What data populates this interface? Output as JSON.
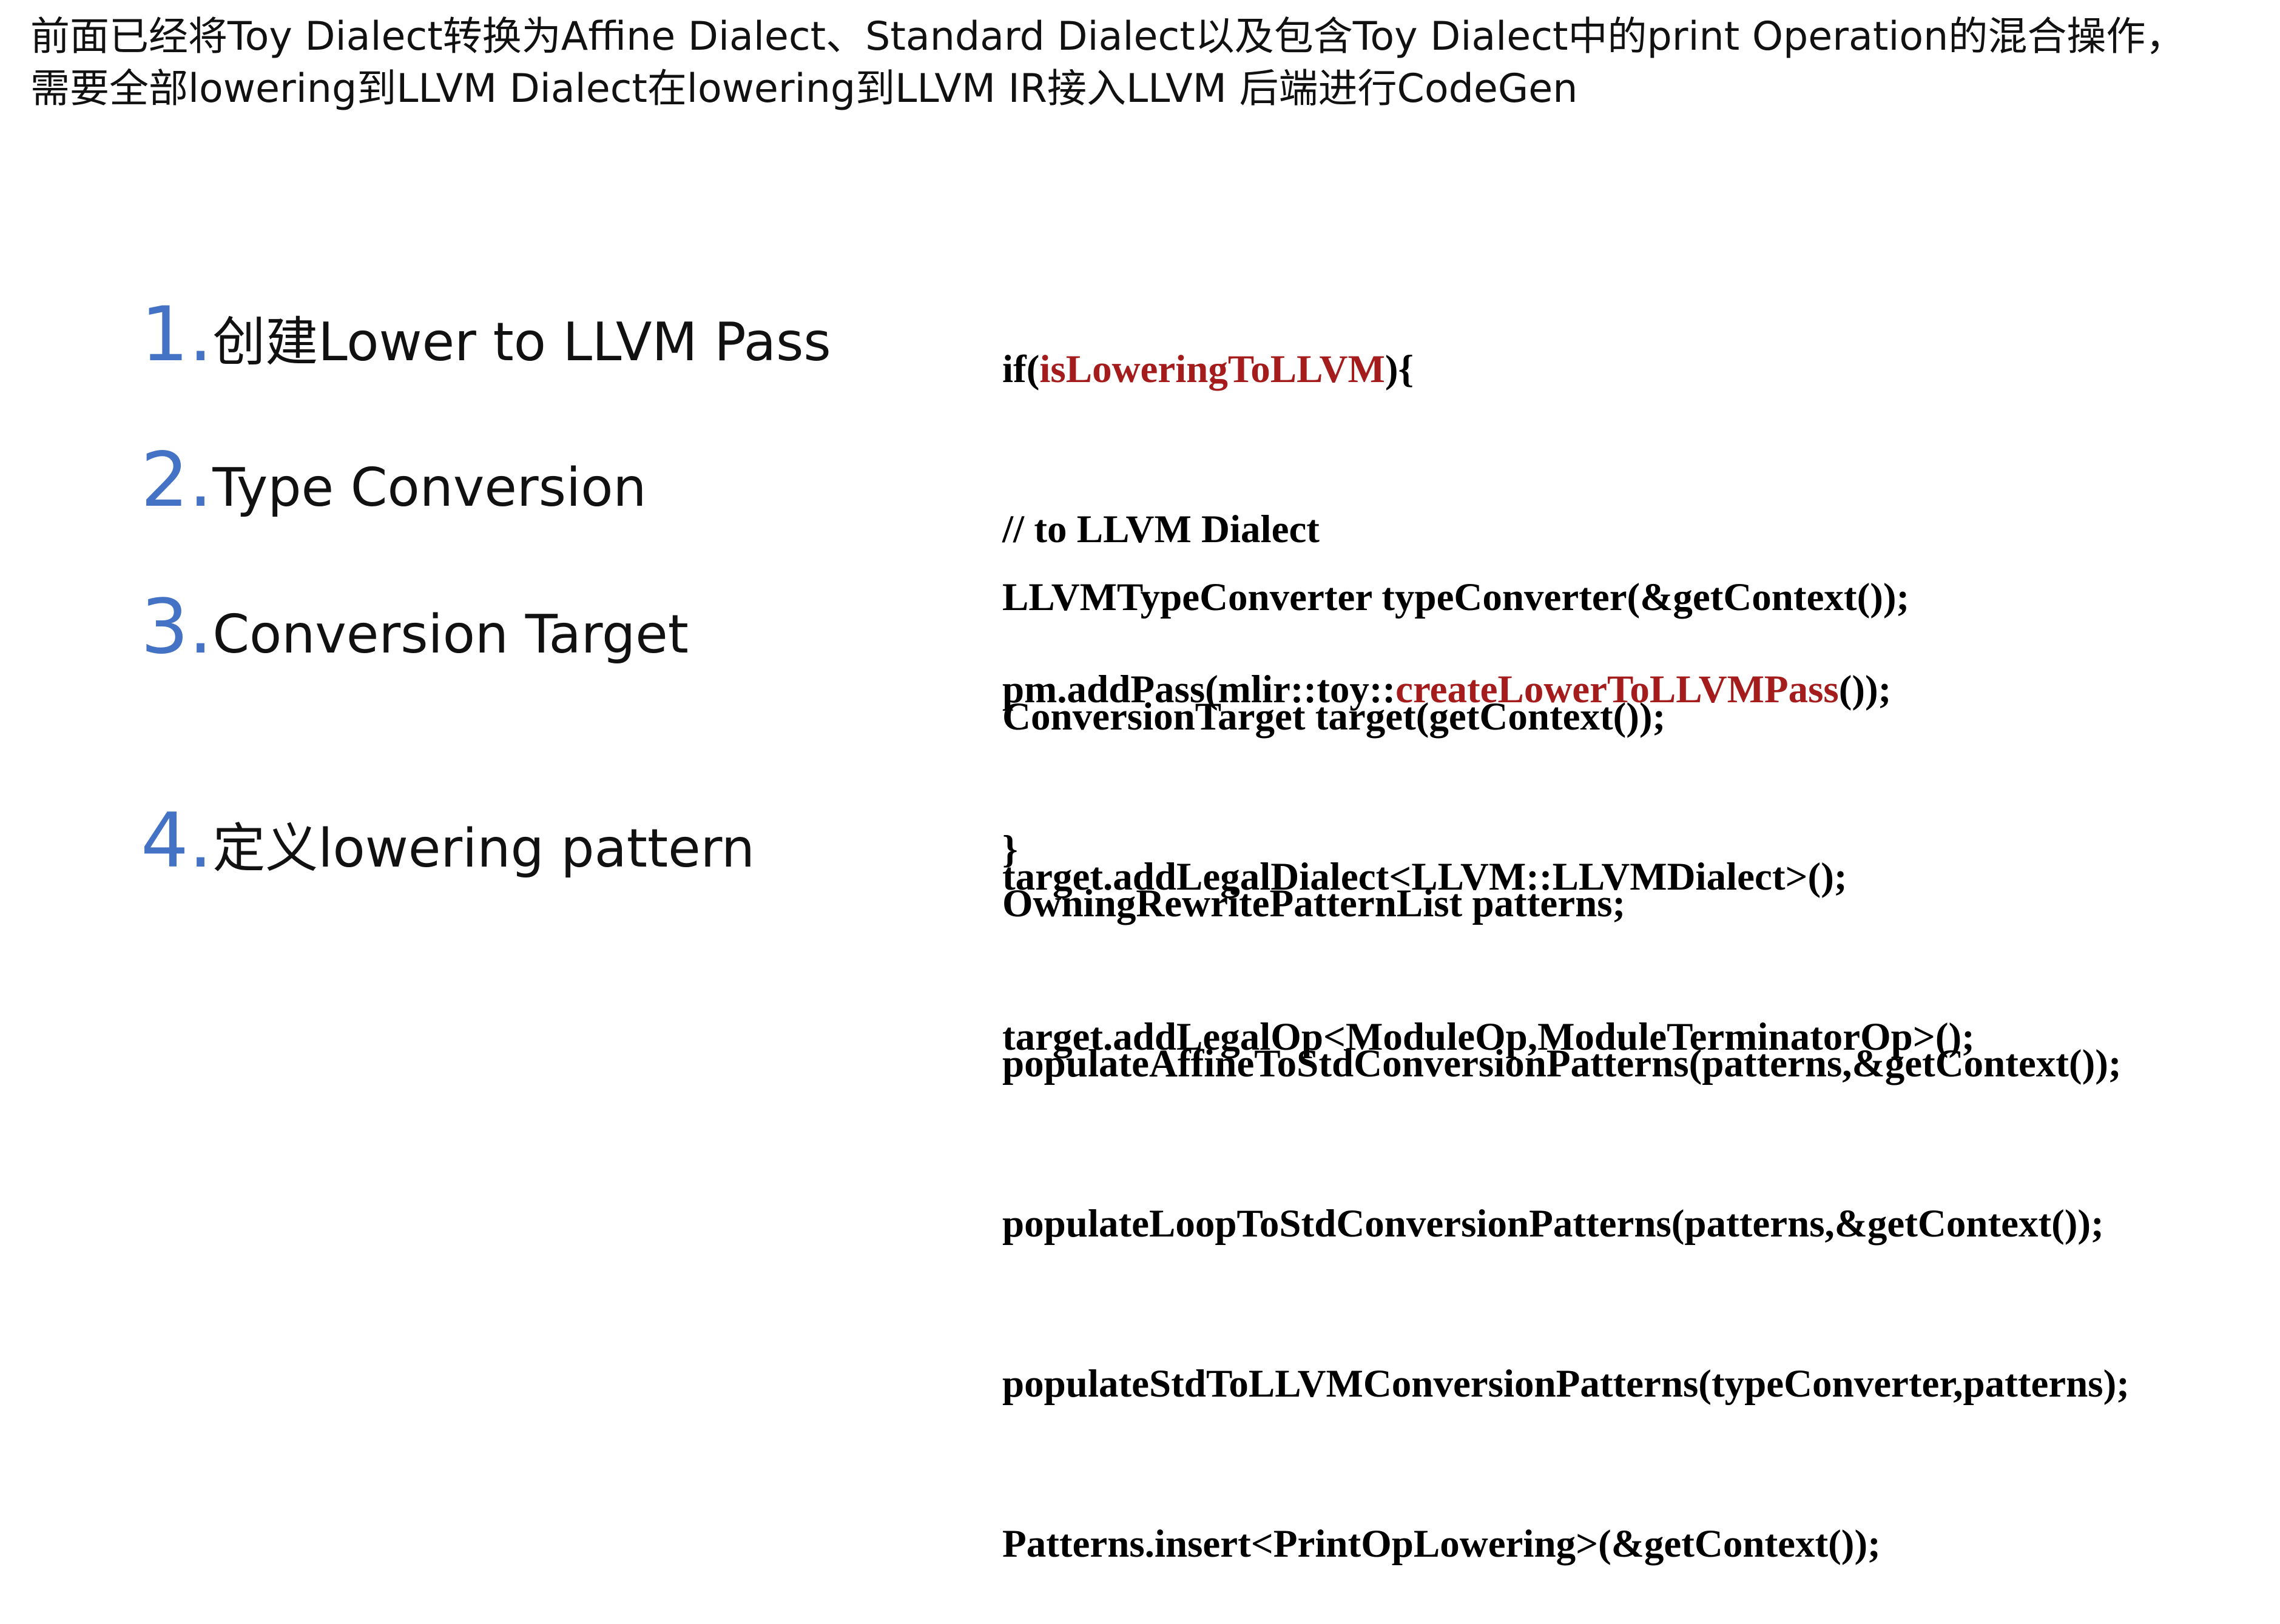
{
  "intro": {
    "line1": "前面已经将Toy Dialect转换为Affine Dialect、Standard Dialect以及包含Toy Dialect中的print Operation的混合操作，",
    "line2": "需要全部lowering到LLVM Dialect在lowering到LLVM IR接入LLVM 后端进行CodeGen"
  },
  "steps": [
    {
      "num": "1.",
      "title": "创建Lower to LLVM Pass",
      "code": {
        "l1_a": "if(",
        "l1_b": "isLoweringToLLVM",
        "l1_c": "){",
        "l2": "// to LLVM Dialect",
        "l3_a": "pm.addPass(mlir::toy::",
        "l3_b": "createLowerToLLVMPass",
        "l3_c": "());",
        "l4": "}"
      }
    },
    {
      "num": "2.",
      "title": "Type Conversion",
      "code": {
        "l1": "LLVMTypeConverter typeConverter(&getContext());"
      }
    },
    {
      "num": "3.",
      "title": "Conversion Target",
      "code": {
        "l1": "ConversionTarget target(getContext());",
        "l2": "target.addLegalDialect<LLVM::LLVMDialect>();",
        "l3": "target.addLegalOp<ModuleOp,ModuleTerminatorOp>();"
      }
    },
    {
      "num": "4.",
      "title": "定义lowering pattern",
      "code": {
        "l1": "OwningRewritePatternList patterns;",
        "l2": "populateAffineToStdConversionPatterns(patterns,&getContext());",
        "l3": "populateLoopToStdConversionPatterns(patterns,&getContext());",
        "l4": "populateStdToLLVMConversionPatterns(typeConverter,patterns);",
        "l5": "Patterns.insert<PrintOpLowering>(&getContext());"
      }
    }
  ],
  "colors": {
    "accent": "#4472C4",
    "highlight": "#A51C1C",
    "text": "#111111"
  }
}
